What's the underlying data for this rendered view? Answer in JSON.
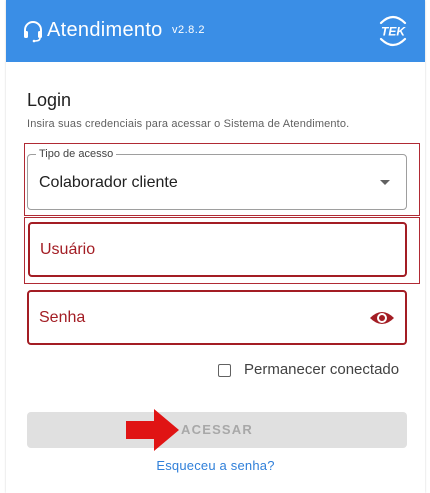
{
  "header": {
    "title": "Atendimento",
    "version": "v2.8.2",
    "logo_text": "TEK",
    "background_color": "#3a8ee6"
  },
  "login": {
    "title": "Login",
    "subtitle": "Insira suas credenciais para acessar o Sistema de Atendimento."
  },
  "fields": {
    "tipo_acesso": {
      "legend": "Tipo de acesso",
      "value": "Colaborador cliente"
    },
    "usuario": {
      "label": "Usuário",
      "value": ""
    },
    "senha": {
      "label": "Senha",
      "value": ""
    }
  },
  "remember": {
    "label": "Permanecer conectado",
    "checked": false
  },
  "buttons": {
    "acessar_label": "ACESSAR",
    "forgot_label": "Esqueceu a senha?"
  },
  "icons": {
    "header_left": "headset-icon",
    "header_right": "tek-logo-icon",
    "tipo_dropdown": "chevron-down-icon",
    "senha_visibility": "eye-icon",
    "annotation": "arrow-right-icon"
  },
  "colors": {
    "error": "#a31d24",
    "link": "#2f7fd9",
    "arrow": "#e01414"
  }
}
